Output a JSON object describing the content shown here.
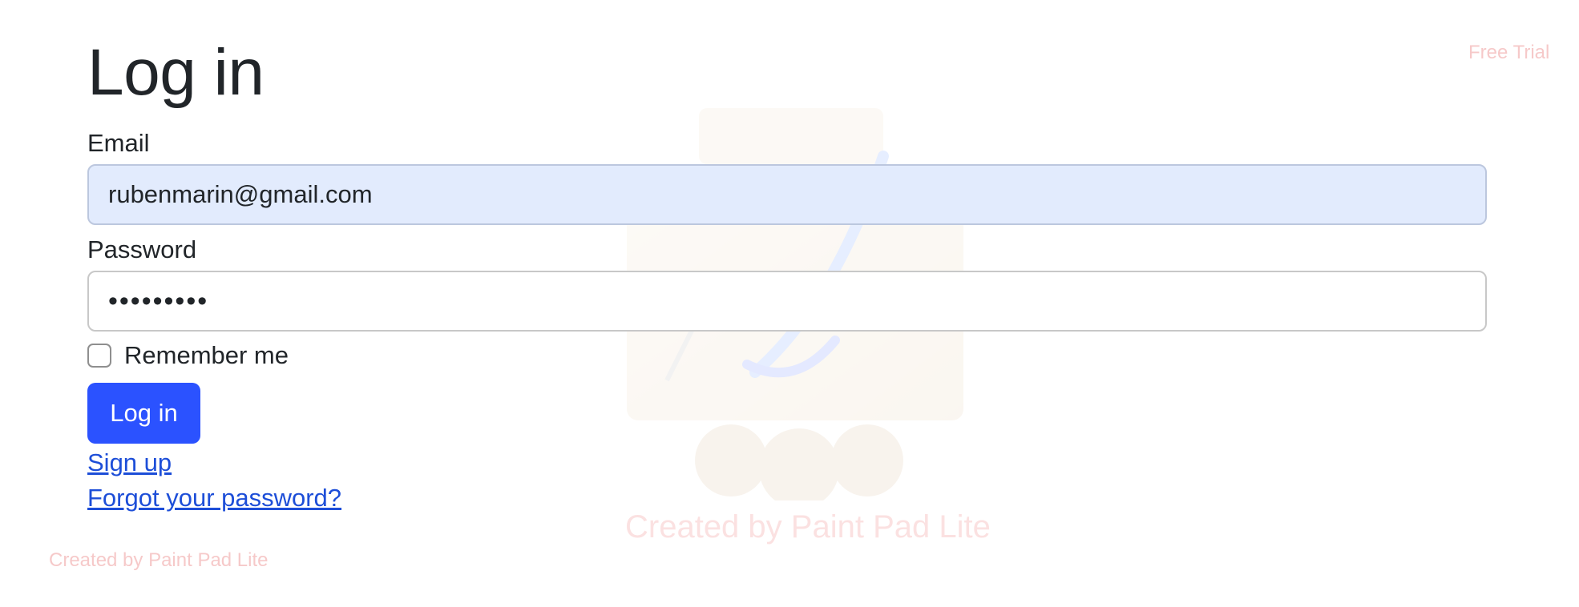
{
  "page": {
    "title": "Log in"
  },
  "form": {
    "email": {
      "label": "Email",
      "value": "rubenmarin@gmail.com",
      "placeholder": ""
    },
    "password": {
      "label": "Password",
      "value": "•••••••••",
      "placeholder": ""
    },
    "remember_me": {
      "label": "Remember me",
      "checked": false
    },
    "submit_label": "Log in"
  },
  "links": {
    "sign_up": "Sign up",
    "forgot_password": "Forgot your password?"
  },
  "watermark": {
    "top_right": "Free Trial",
    "center": "Created by Paint Pad Lite",
    "bottom_left": "Created by Paint Pad Lite"
  },
  "colors": {
    "primary": "#2b52ff",
    "link": "#1d4ed8",
    "autofill_bg": "#e2ebfd",
    "watermark": "#f6c7c7"
  }
}
